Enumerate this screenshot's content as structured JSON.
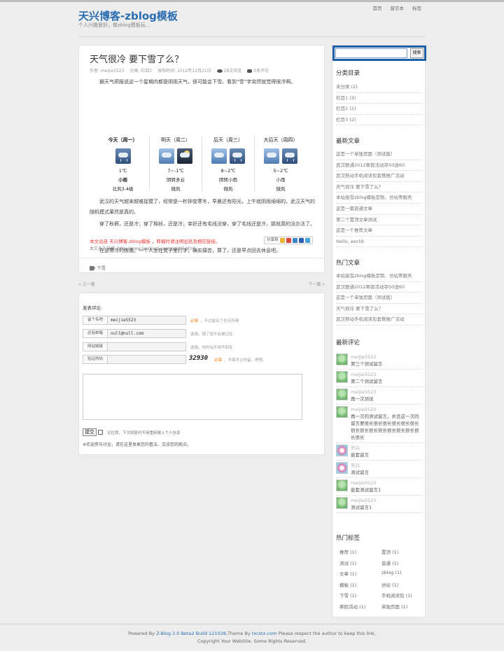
{
  "header": {
    "site_title": "天兴博客-zblog模板",
    "site_subtitle": "个人兴趣爱好，做zblog模板玩...",
    "nav": [
      "首页",
      "留言本",
      "标签"
    ]
  },
  "post": {
    "title": "天气很冷 要下雪了么？",
    "meta": {
      "author": "作者: meijie5523",
      "category": "分类: 栏目2",
      "date": "发布时间: 2012年12月21日",
      "views": "28次浏览",
      "comments": "0条评论"
    },
    "paragraphs": [
      "据天气预报说这一个星期内都是阴雨天气，很可能会下雪。看到“雪”字突然就觉得很冷啊。",
      "武汉的天气越来越难捉摸了，经常是一秒钟变寒冬，早晨还有阳光，上午就阴雨绵绵的。武汉天气的随机模式果然是真的。",
      "穿了秋裤，还是冷；穿了棉袄，还是冷；幸好还有毛线没穿，穿了毛线还是冷，那就真的没办法了。",
      "在这寒冷的夜晚，一个人坐在凳子里打字，确实痛苦，算了，还是早点回去休息吧。"
    ],
    "weather": [
      {
        "day": "今天（周一）",
        "temp": "1℃",
        "desc": "小雨",
        "wind": "北风3-4级",
        "icons": [
          "rain"
        ]
      },
      {
        "day": "明天（周二）",
        "temp": "7~-1℃",
        "desc": "阴转多云",
        "wind": "微风",
        "icons": [
          "day",
          "night"
        ]
      },
      {
        "day": "后天（周三）",
        "temp": "8~2℃",
        "desc": "阴转小雨",
        "wind": "微风",
        "icons": [
          "day",
          "rain"
        ]
      },
      {
        "day": "大后天（周四）",
        "temp": "5~2℃",
        "desc": "小雨",
        "wind": "微风",
        "icons": [
          "day",
          "rain"
        ]
      }
    ],
    "copyright": "本文出自 天兴博客-zblog模板 ，转载时请注明出处及相应链接。",
    "permalink": "本文永久链接: http://www.landouzi.com/post/7.html",
    "share_label": "分享到",
    "tag": "下雪"
  },
  "prevnext": {
    "prev": "« 上一篇",
    "next": "下一篇 »"
  },
  "comment_form": {
    "title": "发表评论:",
    "fields": [
      {
        "label": "留个名吧",
        "value": "meijie5523",
        "required": "必填",
        "hint": "，不过留名了也无所谓"
      },
      {
        "label": "还有邮箱",
        "value": "null@null.com",
        "required": "",
        "hint": "选填，填了就不会被记住"
      },
      {
        "label": "网站链接",
        "value": "",
        "required": "",
        "hint": "选填，你的站不用写网址"
      },
      {
        "label": "验证的码",
        "value": "",
        "required": "必填",
        "hint": "，不填不让你留，嗯嗯。"
      }
    ],
    "captcha": "32930",
    "submit": "提交",
    "remember": "记住我，下次回复时不用重新输入个人信息",
    "note": "※欢迎参与讨论，请在这里发表您的看法、交流您的观点。"
  },
  "sidebar": {
    "search_button": "搜索",
    "categories_title": "分类目录",
    "categories": [
      "未分类 (2)",
      "栏目1 (3)",
      "栏目2 (2)",
      "栏目3 (2)"
    ],
    "latest_title": "最新文章",
    "latest": [
      "这是一个单独页面（测试版）",
      "武汉联通2012寒假活动存50送60",
      "武汉移动手机阅读包套餐推广活动",
      "天气很冷 要下雪了么？",
      "本站接受zblog模板定制、仿站等服务",
      "这是一篇普通文章",
      "第二个置顶文章测试",
      "这是一个推荐文章",
      "Hello, world!"
    ],
    "hot_title": "热门文章",
    "hot": [
      "本站接受zblog模板定制、仿站等服务",
      "武汉联通2012寒假活动存50送60",
      "这是一个单独页面（测试版）",
      "天气很冷 要下雪了么？",
      "武汉移动手机阅读包套餐推广活动"
    ],
    "comments_title": "最新评论",
    "comments": [
      {
        "name": "meijie5523",
        "text": "第三个测试留言",
        "avatar": "green"
      },
      {
        "name": "meijie5523",
        "text": "第二个测试留言",
        "avatar": "green"
      },
      {
        "name": "meijie5523",
        "text": "再一次测试",
        "avatar": "green"
      },
      {
        "name": "meijie5523",
        "text": "再一次的测试留言，并且这一次的留言要很长很长很长很长很长很长很长很长很长很长很长很长很长很长很长",
        "avatar": "green"
      },
      {
        "name": "天兴",
        "text": "嵌套留言",
        "avatar": "pink"
      },
      {
        "name": "天兴",
        "text": "测试留言",
        "avatar": "pink"
      },
      {
        "name": "meijie5523",
        "text": "嵌套测试留言1",
        "avatar": "green"
      },
      {
        "name": "meijie5523",
        "text": "测试留言1",
        "avatar": "green"
      }
    ],
    "tags_title": "热门标签",
    "tags": [
      "推荐 (1)",
      "置顶 (1)",
      "测试 (1)",
      "普通 (1)",
      "文章 (1)",
      "zblog (1)",
      "模板 (1)",
      "仿站 (1)",
      "下雪 (1)",
      "手机阅读包 (1)",
      "寒假活动 (1)",
      "单独页面 (1)"
    ]
  },
  "footer": {
    "line1_pre": "Powered By ",
    "line1_link1": "Z-Blog 2.0 Beta2 Build 121028",
    "line1_mid": ",Theme By ",
    "line1_link2": "txcstx.com",
    "line1_post": " Please respect the author to keep this link,",
    "line2": "Copyright Your WebSite. Some Rights Reserved."
  }
}
